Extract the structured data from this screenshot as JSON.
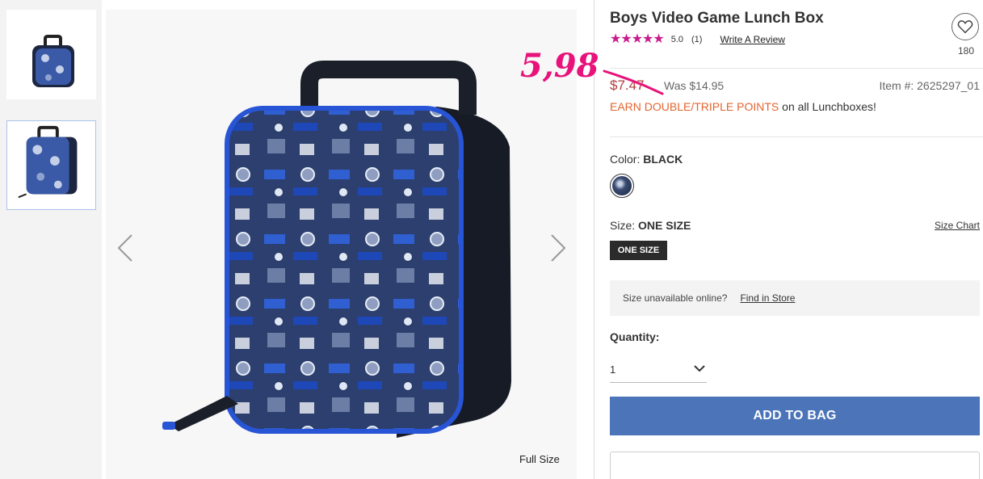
{
  "product": {
    "title": "Boys Video Game Lunch Box",
    "rating_stars": "★★★★★",
    "rating_value": "5.0",
    "rating_count": "(1)",
    "write_review_label": "Write A Review",
    "favorites_count": "180",
    "price_now": "$7.47",
    "price_was": "Was $14.95",
    "item_number": "Item #: 2625297_01",
    "promo_highlight": "EARN DOUBLE/TRIPLE POINTS",
    "promo_rest": " on all Lunchboxes!"
  },
  "color": {
    "label": "Color:",
    "value": "BLACK"
  },
  "size": {
    "label": "Size:",
    "value": "ONE SIZE",
    "chart_label": "Size Chart",
    "option_label": "ONE SIZE"
  },
  "availability": {
    "text": "Size unavailable online?",
    "find_store_label": "Find in Store"
  },
  "quantity": {
    "label": "Quantity:",
    "value": "1"
  },
  "actions": {
    "add_to_bag_label": "ADD TO BAG"
  },
  "gallery": {
    "full_size_label": "Full Size"
  },
  "annotation": {
    "handwritten_price": "5,98"
  },
  "colors": {
    "star": "#c81b8c",
    "price_now": "#b33a3a",
    "promo": "#e3642f",
    "add_to_bag": "#4c74b9",
    "annotation": "#e8127a"
  }
}
